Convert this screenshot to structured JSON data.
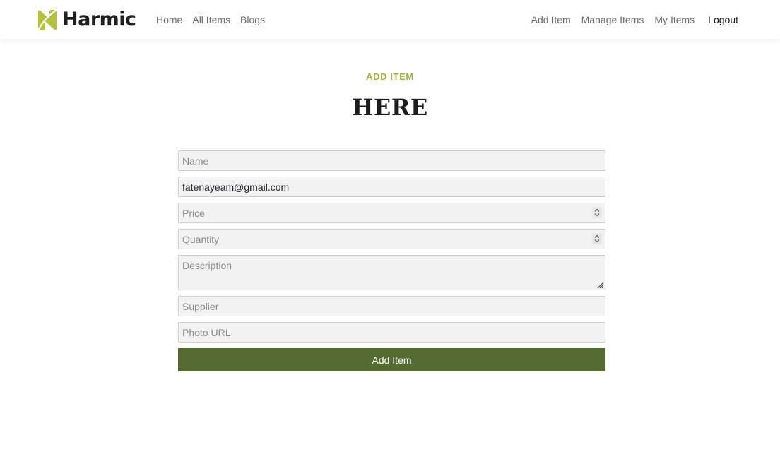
{
  "brand": {
    "name": "Harmic",
    "logo_icon": "leaf-logo-icon",
    "logo_color": "#b5c13b"
  },
  "nav": {
    "left": [
      {
        "label": "Home"
      },
      {
        "label": "All Items"
      },
      {
        "label": "Blogs"
      }
    ],
    "right": [
      {
        "label": "Add Item"
      },
      {
        "label": "Manage Items"
      },
      {
        "label": "My Items"
      }
    ],
    "logout": "Logout"
  },
  "section": {
    "subtitle": "ADD ITEM",
    "title": "HERE",
    "subtitle_color": "#9fb43f"
  },
  "form": {
    "name": {
      "placeholder": "Name",
      "value": ""
    },
    "email": {
      "placeholder": "",
      "value": "fatenayeam@gmail.com"
    },
    "price": {
      "placeholder": "Price",
      "value": ""
    },
    "quantity": {
      "placeholder": "Quantity",
      "value": ""
    },
    "description": {
      "placeholder": "Description",
      "value": ""
    },
    "supplier": {
      "placeholder": "Supplier",
      "value": ""
    },
    "photo_url": {
      "placeholder": "Photo URL",
      "value": ""
    },
    "submit_label": "Add Item",
    "submit_color": "#556b2f"
  }
}
